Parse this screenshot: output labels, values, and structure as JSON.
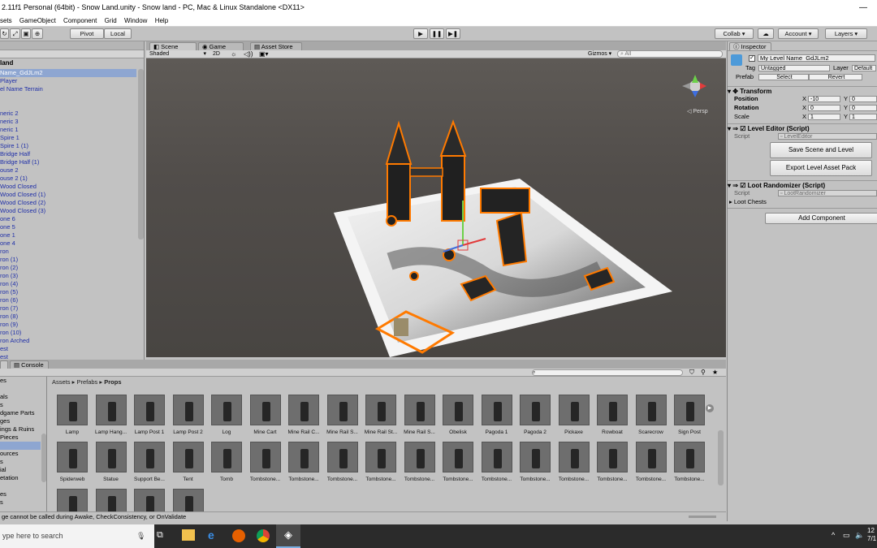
{
  "title_bar": {
    "text": "2.11f1 Personal (64bit) - Snow Land.unity - Snow land - PC, Mac & Linux Standalone <DX11>",
    "minimize": "—"
  },
  "menu": [
    "sets",
    "GameObject",
    "Component",
    "Grid",
    "Window",
    "Help"
  ],
  "toolbar": {
    "pivot": "Pivot",
    "local": "Local",
    "play_icon": "play-icon",
    "pause_icon": "pause-icon",
    "step_icon": "step-icon",
    "collab": "Collab ▾",
    "cloud_icon": "cloud-icon",
    "account": "Account ▾",
    "layers": "Layers ▾"
  },
  "hierarchy": {
    "title": "land",
    "items": [
      "Name_GdJLm2",
      " Player",
      "el Name Terrain",
      "",
      "",
      "neric 2",
      "neric 3",
      "neric 1",
      "Spire 1",
      "Spire 1 (1)",
      "Bridge Half",
      "Bridge Half (1)",
      "ouse 2",
      "ouse 2 (1)",
      "Wood Closed",
      "Wood Closed (1)",
      "Wood Closed (2)",
      "Wood Closed (3)",
      "one 6",
      "one 5",
      "one 1",
      "one 4",
      "ron",
      "ron (1)",
      "ron (2)",
      "ron (3)",
      "ron (4)",
      "ron (5)",
      "ron (6)",
      "ron (7)",
      "ron (8)",
      "ron (9)",
      "ron (10)",
      "ron Arched",
      "est",
      "est"
    ]
  },
  "scene": {
    "tabs": [
      "Scene",
      "Game",
      "Asset Store"
    ],
    "shading": "Shaded",
    "mode_2d": "2D",
    "gizmos": "Gizmos ▾",
    "search_placeholder": "All",
    "persp": "Persp"
  },
  "bottom_tabs": [
    "",
    "Console"
  ],
  "project": {
    "left_items": [
      "es",
      "",
      "als",
      "s",
      "dgame Parts",
      "ges",
      "ings & Ruins",
      "Pieces",
      "",
      "ources",
      "s",
      "ial",
      "etation",
      "",
      "es",
      "s"
    ],
    "breadcrumb": [
      "Assets",
      "Prefabs",
      "Props"
    ],
    "assets_row1": [
      "Lamp",
      "Lamp Hang...",
      "Lamp Post 1",
      "Lamp Post 2",
      "Log",
      "Mine Cart",
      "Mine Rail C...",
      "Mine Rail S...",
      "Mine Rail St...",
      "Mine Rail S...",
      "Obelisk",
      "Pagoda 1",
      "Pagoda 2",
      "Pickaxe",
      "Rowboat",
      "Scarecrow",
      "Sign Post"
    ],
    "assets_row2": [
      "Spiderweb",
      "Statue",
      "Support Be...",
      "Tent",
      "Tomb",
      "Tombstone...",
      "Tombstone...",
      "Tombstone...",
      "Tombstone...",
      "Tombstone...",
      "Tombstone...",
      "Tombstone...",
      "Tombstone...",
      "Tombstone...",
      "Tombstone...",
      "Tombstone...",
      "Tombstone..."
    ],
    "assets_row3": [
      "",
      "",
      "",
      ""
    ]
  },
  "status": "ge cannot be called during Awake, CheckConsistency, or OnValidate",
  "inspector": {
    "tab": "Inspector",
    "object_name": "My Level Name_GdJLm2",
    "tag_label": "Tag",
    "tag_value": "Untagged",
    "layer_label": "Layer",
    "layer_value": "Default",
    "prefab_label": "Prefab",
    "prefab_select": "Select",
    "prefab_revert": "Revert",
    "transform": {
      "title": "Transform",
      "position_label": "Position",
      "rotation_label": "Rotation",
      "scale_label": "Scale",
      "x_label": "X",
      "y_label": "Y",
      "position_x": "-10",
      "position_y": "0",
      "rotation_x": "0",
      "rotation_y": "0",
      "scale_x": "1",
      "scale_y": "1"
    },
    "level_editor": {
      "title": "Level Editor (Script)",
      "script_label": "Script",
      "script_value": "LevelEditor",
      "save_button": "Save Scene and Level",
      "export_button": "Export Level Asset Pack"
    },
    "loot": {
      "title": "Loot Randomizer (Script)",
      "script_label": "Script",
      "script_value": "LootRandomizer",
      "chests_label": "Loot Chests"
    },
    "add_component": "Add Component"
  },
  "taskbar": {
    "search_placeholder": "ype here to search",
    "clock_top": "12",
    "clock_bottom": "7/1"
  }
}
